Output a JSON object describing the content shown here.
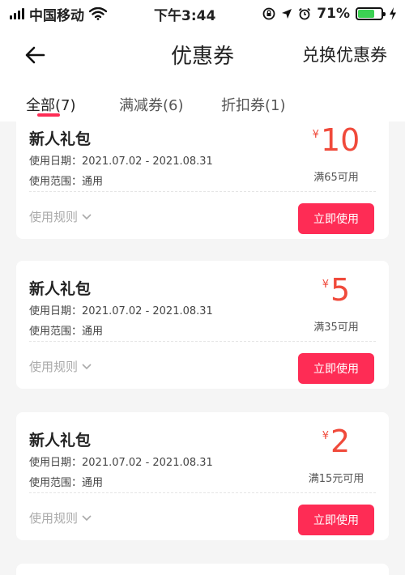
{
  "status_bar": {
    "carrier": "中国移动",
    "time": "下午3:44",
    "battery_pct": "71%",
    "battery_level": 0.71
  },
  "header": {
    "title": "优惠券",
    "action": "兑换优惠券"
  },
  "tabs": [
    {
      "label": "全部(7)"
    },
    {
      "label": "满减券(6)"
    },
    {
      "label": "折扣券(1)"
    }
  ],
  "coupons": [
    {
      "title": "新人礼包",
      "date_line": "使用日期：2021.07.02 - 2021.08.31",
      "scope_line": "使用范围：通用",
      "currency": "¥",
      "amount": "10",
      "condition": "满65可用",
      "rules_label": "使用规则",
      "use_label": "立即使用"
    },
    {
      "title": "新人礼包",
      "date_line": "使用日期：2021.07.02 - 2021.08.31",
      "scope_line": "使用范围：通用",
      "currency": "¥",
      "amount": "5",
      "condition": "满35可用",
      "rules_label": "使用规则",
      "use_label": "立即使用"
    },
    {
      "title": "新人礼包",
      "date_line": "使用日期：2021.07.02 - 2021.08.31",
      "scope_line": "使用范围：通用",
      "currency": "¥",
      "amount": "2",
      "condition": "满15元可用",
      "rules_label": "使用规则",
      "use_label": "立即使用"
    }
  ],
  "colors": {
    "accent": "#fe2c55",
    "price": "#f04a3b",
    "battery": "#3cd153"
  }
}
